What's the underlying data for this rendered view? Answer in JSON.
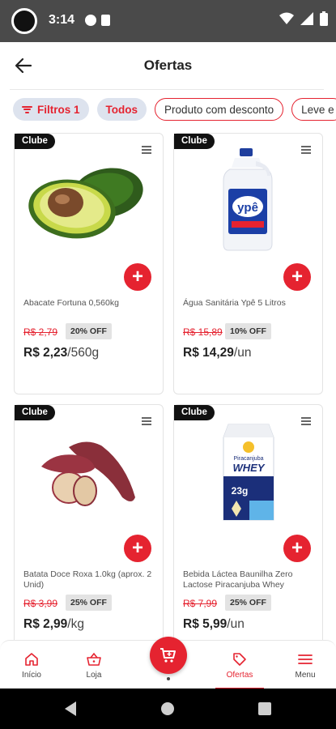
{
  "status_bar": {
    "time": "3:14",
    "icons": [
      "camera-icon",
      "notification-icon",
      "sim-icon",
      "wifi-icon",
      "signal-icon",
      "battery-icon"
    ]
  },
  "header": {
    "title": "Ofertas",
    "back_icon": "arrow-left-icon"
  },
  "filters": {
    "filter_label": "Filtros",
    "filter_count": "1",
    "chips": [
      "Todos",
      "Produto com desconto",
      "Leve e"
    ]
  },
  "products": [
    {
      "badge": "Clube",
      "name": "Abacate Fortuna 0,560kg",
      "old_price": "R$ 2,79",
      "discount": "20% OFF",
      "price": "R$ 2,23",
      "unit": "/560g",
      "image": "avocado"
    },
    {
      "badge": "Clube",
      "name": "Água Sanitária Ypê 5 Litros",
      "old_price": "R$ 15,89",
      "discount": "10% OFF",
      "price": "R$ 14,29",
      "unit": "/un",
      "image": "bleach-bottle"
    },
    {
      "badge": "Clube",
      "name": "Batata Doce Roxa 1.0kg (aprox. 2 Unid)",
      "old_price": "R$ 3,99",
      "discount": "25% OFF",
      "price": "R$ 2,99",
      "unit": "/kg",
      "image": "sweet-potato"
    },
    {
      "badge": "Clube",
      "name": "Bebida Láctea Baunilha Zero Lactose Piracanjuba Whey Caixa...",
      "old_price": "R$ 7,99",
      "discount": "25% OFF",
      "price": "R$ 5,99",
      "unit": "/un",
      "image": "whey-carton",
      "carton_brand": "Piracanjuba",
      "carton_title": "WHEY",
      "carton_protein": "23g"
    }
  ],
  "bottom_nav": {
    "items": [
      {
        "label": "Início",
        "icon": "home-icon"
      },
      {
        "label": "Loja",
        "icon": "basket-icon"
      },
      {
        "label": "Ofertas",
        "icon": "tag-icon",
        "active": true
      },
      {
        "label": "Menu",
        "icon": "menu-icon"
      }
    ],
    "cart_icon": "cart-icon"
  },
  "colors": {
    "brand_red": "#e52330",
    "status_bar": "#4a4a4a",
    "chip_filled_bg": "#dde3ee",
    "badge_bg": "#111111"
  }
}
